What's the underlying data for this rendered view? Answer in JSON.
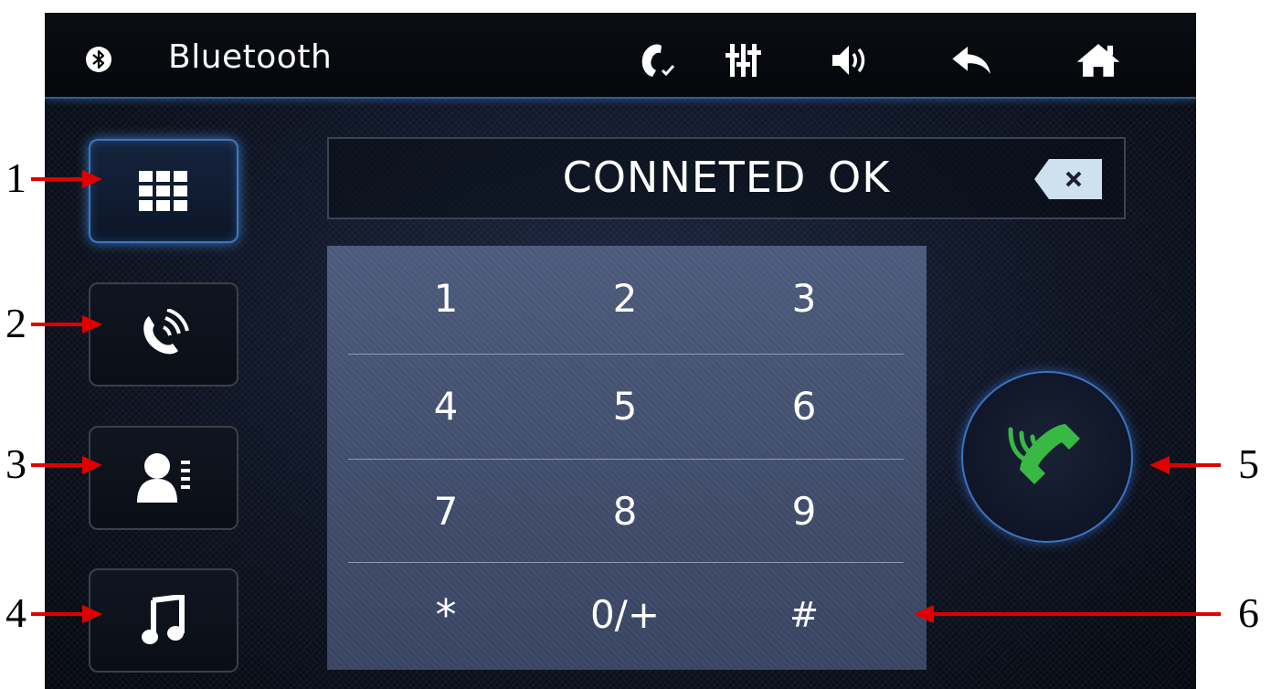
{
  "topbar": {
    "title": "Bluetooth",
    "icons": [
      "bluetooth-icon",
      "phone-check-icon",
      "equalizer-icon",
      "volume-icon",
      "back-icon",
      "home-icon"
    ]
  },
  "sidebar": {
    "items": [
      {
        "name": "dialpad",
        "icon": "dialpad-icon",
        "active": true
      },
      {
        "name": "call-log",
        "icon": "phone-ringing-icon",
        "active": false
      },
      {
        "name": "contacts",
        "icon": "contacts-icon",
        "active": false
      },
      {
        "name": "music",
        "icon": "music-note-icon",
        "active": false
      }
    ]
  },
  "display": {
    "text": "CONNETED  OK"
  },
  "keypad": {
    "rows": [
      [
        "1",
        "2",
        "3"
      ],
      [
        "4",
        "5",
        "6"
      ],
      [
        "7",
        "8",
        "9"
      ],
      [
        "*",
        "0/+",
        "#"
      ]
    ]
  },
  "callouts": {
    "c1": "1",
    "c2": "2",
    "c3": "3",
    "c4": "4",
    "c5": "5",
    "c6": "6"
  },
  "colors": {
    "accent_blue": "#3d79c0",
    "call_green": "#38b944",
    "arrow_red": "#e00000"
  }
}
